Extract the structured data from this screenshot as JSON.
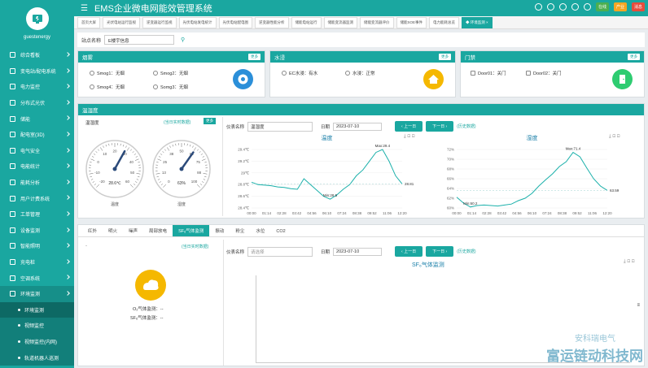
{
  "app": {
    "user": "guestenergy",
    "title": "EMS企业微电网能效管理系统"
  },
  "sidebar": {
    "items": [
      {
        "label": "综合看板"
      },
      {
        "label": "变电站/配电系统"
      },
      {
        "label": "电力监控"
      },
      {
        "label": "分布式光伏"
      },
      {
        "label": "储能"
      },
      {
        "label": "配电室(3D)"
      },
      {
        "label": "电气安全"
      },
      {
        "label": "电能统计"
      },
      {
        "label": "能耗分析"
      },
      {
        "label": "用户计费系统"
      },
      {
        "label": "工单管理"
      },
      {
        "label": "设备监测"
      },
      {
        "label": "智能照明"
      },
      {
        "label": "充电桩"
      },
      {
        "label": "空调系统"
      },
      {
        "label": "环境监测"
      }
    ],
    "sub": [
      {
        "label": "环境监测"
      },
      {
        "label": "视频监控"
      },
      {
        "label": "视频监控(内网)"
      },
      {
        "label": "轨道机器人巡测"
      }
    ]
  },
  "topbar": {
    "badges": [
      "在线",
      "产业",
      "消息"
    ]
  },
  "tabs": [
    "首页大屏",
    "光伏电站运行监视",
    "逆变器运行监视",
    "光伏电站发电统计",
    "光伏电站配电图",
    "逆变器性能分析",
    "储能电站运行",
    "储能变流器监测",
    "储能变流器评价",
    "储能SOE事件",
    "电力能耗总览",
    "◆ 环境监测 ×"
  ],
  "site": {
    "label": "站点名称",
    "value": "E楼宇信息"
  },
  "smoke": {
    "title": "烟雾",
    "more": "更多",
    "items": [
      "Smog1：无烟",
      "Smog2：无烟",
      "Smog4：无烟",
      "Somg3：无烟"
    ]
  },
  "water": {
    "title": "水浸",
    "more": "更多",
    "items": [
      "EC水浸：有水",
      "水浸：正常"
    ]
  },
  "door": {
    "title": "门禁",
    "more": "更多",
    "items": [
      "Door01：关门",
      "Door02：关门"
    ]
  },
  "th": {
    "title": "温湿度",
    "panel_label": "温湿度",
    "live": "(当日实时数据)",
    "more": "更多",
    "gauges": [
      {
        "value": 28.6,
        "unit": "℃",
        "min": "-20",
        "max": "60",
        "text": "28.6℃",
        "label": "温度"
      },
      {
        "value": 63,
        "unit": "%",
        "min": "0",
        "max": "100",
        "text": "63%",
        "label": "湿度"
      }
    ],
    "device_label": "仪表名称",
    "device": "温湿度",
    "date_label": "日期",
    "date": "2023-07-10",
    "prev": "上一日",
    "next": "下一日",
    "history": "(历史数据)"
  },
  "chart_data": [
    {
      "type": "line",
      "title": "温度",
      "ylim": [
        28.4,
        29.4
      ],
      "yticks": [
        "29.4℃",
        "29.2℃",
        "29℃",
        "28.8℃",
        "28.6℃",
        "28.4℃"
      ],
      "x": [
        "00:00",
        "01:14",
        "02:28",
        "03:42",
        "04:56",
        "06:10",
        "07:24",
        "08:38",
        "09:52",
        "11:06",
        "12:20"
      ],
      "annotations": [
        "Max:29.4",
        "Min:28.5",
        "28.81"
      ],
      "values": [
        28.84,
        28.8,
        28.79,
        28.78,
        28.76,
        28.75,
        28.73,
        28.72,
        28.9,
        28.8,
        28.7,
        28.6,
        28.55,
        28.62,
        28.72,
        28.8,
        28.95,
        29.05,
        29.2,
        29.35,
        29.4,
        29.2,
        28.95,
        28.81
      ]
    },
    {
      "type": "line",
      "title": "湿度",
      "ylim": [
        60,
        72
      ],
      "yticks": [
        "72%",
        "70%",
        "68%",
        "66%",
        "64%",
        "62%",
        "60%"
      ],
      "x": [
        "00:00",
        "01:14",
        "02:28",
        "03:42",
        "04:56",
        "06:10",
        "07:24",
        "08:38",
        "09:52",
        "11:06",
        "12:20"
      ],
      "annotations": [
        "Max:71.4",
        "Min:60.2",
        "63.59"
      ],
      "values": [
        62.2,
        61.0,
        60.2,
        60.5,
        60.6,
        60.5,
        60.4,
        60.6,
        60.8,
        61.5,
        62.0,
        63.0,
        64.5,
        65.8,
        67.0,
        68.5,
        69.5,
        71.4,
        70.5,
        68.2,
        66.0,
        64.5,
        63.59
      ]
    },
    {
      "type": "line",
      "title": "SF₆气体监测",
      "x": [],
      "values": []
    }
  ],
  "sf": {
    "tabs": [
      "红外",
      "明火",
      "噪声",
      "局部放电",
      "SF₆气体监测",
      "振动",
      "粉尘",
      "水位",
      "CO2"
    ],
    "live": "(当日实时数据)",
    "o2": "O₂气体监测：--",
    "sf6": "SF₆气体监测：--",
    "device_label": "仪表名称",
    "device": "请选择",
    "date_label": "日期",
    "date": "2023-07-10",
    "prev": "上一日",
    "next": "下一日",
    "history": "(历史数据)"
  },
  "watermark": {
    "line1": "安科瑞电气",
    "line2": "富运链动科技网"
  }
}
